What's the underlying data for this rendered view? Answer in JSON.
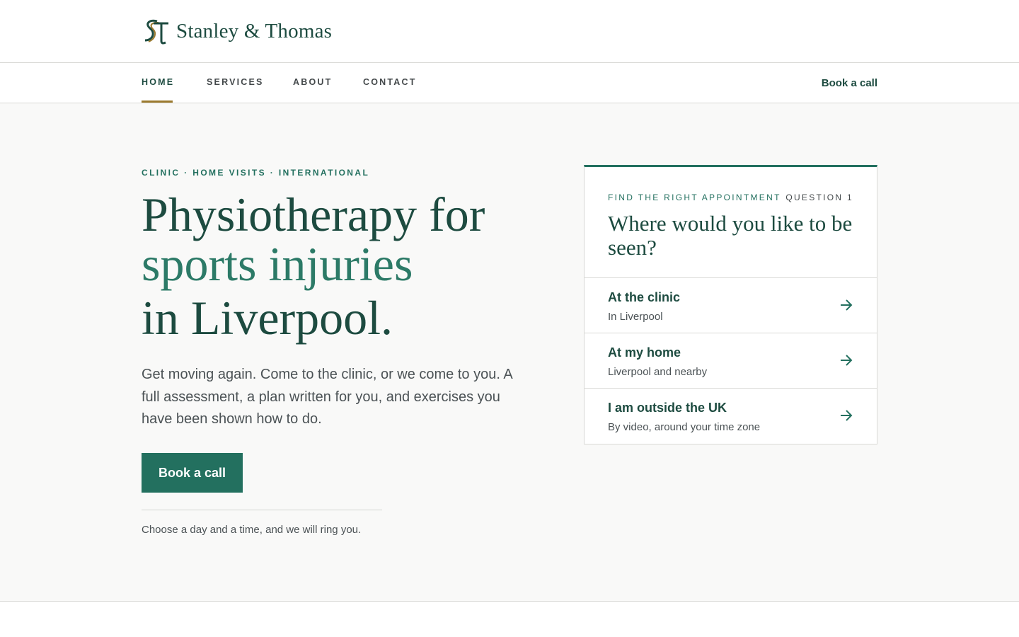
{
  "brand": {
    "name": "Stanley & Thomas",
    "logo_icon": "st-monogram-icon"
  },
  "nav": {
    "items": [
      {
        "label": "HOME",
        "active": true
      },
      {
        "label": "SERVICES",
        "active": false
      },
      {
        "label": "ABOUT",
        "active": false
      },
      {
        "label": "CONTACT",
        "active": false
      }
    ],
    "cta_label": "Book a call"
  },
  "hero": {
    "eyebrow": "CLINIC · HOME VISITS · INTERNATIONAL",
    "headline": {
      "line1": "Physiotherapy for",
      "line2": "sports injuries",
      "line3": "in Liverpool."
    },
    "lede": "Get moving again. Come to the clinic, or we come to you. A full assessment, a plan written for you, and exercises you have been shown how to do.",
    "cta_label": "Book a call",
    "note": "Choose a day and a time, and we will ring you."
  },
  "finder": {
    "eyebrow": "FIND THE RIGHT APPOINTMENT",
    "step": "QUESTION 1",
    "question": "Where would you like to be seen?",
    "options": [
      {
        "title": "At the clinic",
        "subtitle": "In Liverpool",
        "icon": "arrow-right-icon"
      },
      {
        "title": "At my home",
        "subtitle": "Liverpool and nearby",
        "icon": "arrow-right-icon"
      },
      {
        "title": "I am outside the UK",
        "subtitle": "By video, around your time zone",
        "icon": "arrow-right-icon"
      }
    ]
  },
  "colors": {
    "primary": "#1d4b40",
    "accent": "#23705f",
    "highlight": "#2c7a67",
    "gold": "#9b7a2e",
    "hero_bg": "#f9f9f8"
  }
}
